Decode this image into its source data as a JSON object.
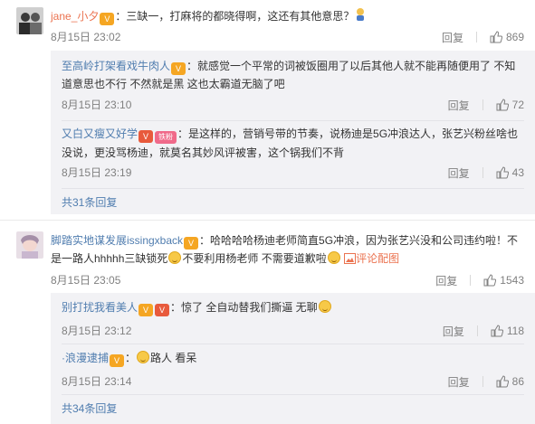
{
  "comments": [
    {
      "user": "jane_小夕",
      "text": "：三缺一，打麻将的都晓得啊，这还有其他意思？",
      "time": "8月15日 23:02",
      "reply_label": "回复",
      "likes": "869",
      "replies": [
        {
          "user": "至高岭打架看戏牛肉人",
          "text": "：就感觉一个平常的词被饭圈用了以后其他人就不能再随便用了  不知道意思也不行  不然就是黑  这也太霸道无脑了吧",
          "time": "8月15日 23:10",
          "reply_label": "回复",
          "likes": "72"
        },
        {
          "user": "又白又瘦又好学",
          "badge": "铁粉",
          "text": "：是这样的，营销号带的节奏，说杨迪是5G冲浪达人，张艺兴粉丝啥也没说，更没骂杨迪，就莫名其妙风评被害，这个锅我们不背",
          "time": "8月15日 23:19",
          "reply_label": "回复",
          "likes": "43"
        }
      ],
      "more_replies": "共31条回复"
    },
    {
      "user": "脚踏实地谋发展issingxback",
      "text_a": "：哈哈哈哈杨迪老师简直5G冲浪，因为张艺兴没和公司违约啦！不是一路人hhhhh三缺锁死",
      "text_b": "不要利用杨老师  不需要道歉啦",
      "text_c": "评论配图",
      "time": "8月15日 23:05",
      "reply_label": "回复",
      "likes": "1543",
      "replies": [
        {
          "user": "别打扰我看美人",
          "text": "：惊了  全自动替我们撕逼  无聊",
          "time": "8月15日 23:12",
          "reply_label": "回复",
          "likes": "118"
        },
        {
          "user": "浪漫逮捕",
          "text": "路人  看呆",
          "time": "8月15日 23:14",
          "reply_label": "回复",
          "likes": "86"
        }
      ],
      "more_replies": "共34条回复"
    }
  ]
}
